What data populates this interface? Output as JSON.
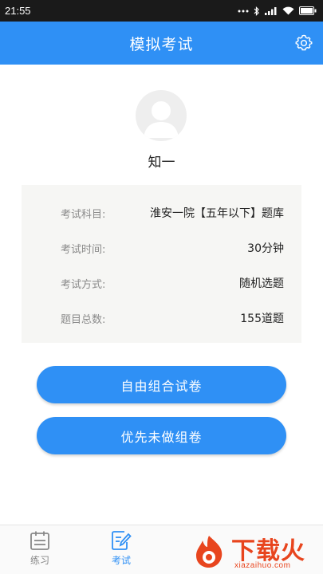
{
  "status_bar": {
    "time": "21:55",
    "icons": [
      "signal-dots-icon",
      "bluetooth-icon",
      "cellular-signal-icon",
      "wifi-icon",
      "battery-icon"
    ]
  },
  "header": {
    "title": "模拟考试",
    "settings_icon": "gear-icon",
    "background": "#2f90f5"
  },
  "profile": {
    "avatar_icon": "user-avatar-icon",
    "name": "知一"
  },
  "exam_info": [
    {
      "label": "考试科目:",
      "value": "淮安一院【五年以下】题库"
    },
    {
      "label": "考试时间:",
      "value": "30分钟"
    },
    {
      "label": "考试方式:",
      "value": "随机选题"
    },
    {
      "label": "题目总数:",
      "value": "155道题"
    }
  ],
  "actions": {
    "free_compose_label": "自由组合试卷",
    "unanswered_first_label": "优先未做组卷"
  },
  "tabs": [
    {
      "label": "练习",
      "icon": "calendar-icon",
      "active": false,
      "color": "#888888"
    },
    {
      "label": "考试",
      "icon": "edit-note-icon",
      "active": true,
      "color": "#2f90f5"
    }
  ],
  "watermark": {
    "brand": "下载火",
    "url": "xiazaihuo.com",
    "logo_icon": "flame-logo-icon"
  }
}
